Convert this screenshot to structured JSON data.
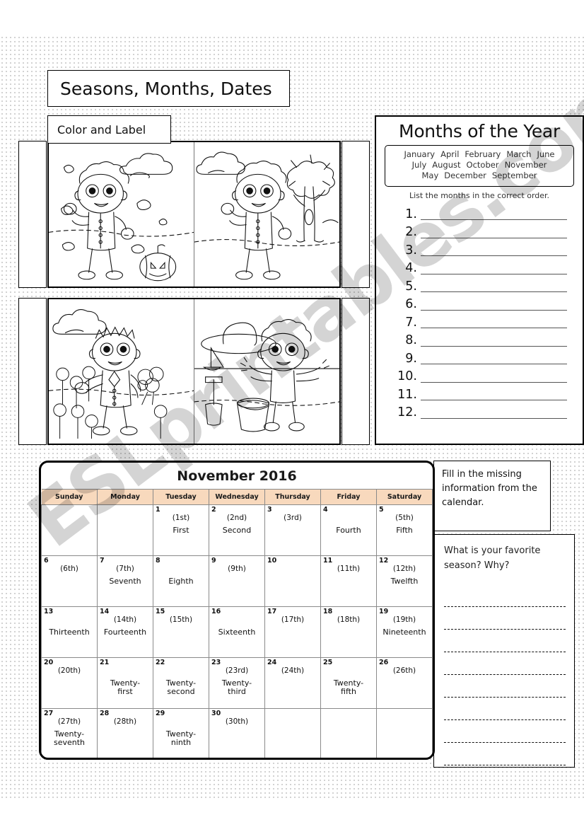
{
  "page": {
    "title": "Seasons, Months, Dates",
    "subtitle": "Color and Label",
    "watermark": "ESLprintables.com"
  },
  "seasons": {
    "panels": [
      {
        "name": "fall-boy-leaves-pumpkin",
        "season": "Fall"
      },
      {
        "name": "autumn-boy-tree",
        "season": "Autumn"
      },
      {
        "name": "spring-boy-flowers",
        "season": "Spring"
      },
      {
        "name": "summer-boy-beach",
        "season": "Summer"
      }
    ]
  },
  "months": {
    "heading": "Months of the Year",
    "word_bank": [
      "January",
      "April",
      "February",
      "March",
      "June",
      "July",
      "August",
      "October",
      "November",
      "May",
      "December",
      "September"
    ],
    "instruction": "List the months in the correct order.",
    "numbers": [
      "1.",
      "2.",
      "3.",
      "4.",
      "5.",
      "6.",
      "7.",
      "8.",
      "9.",
      "10.",
      "11.",
      "12."
    ]
  },
  "calendar": {
    "title": "November 2016",
    "weekdays": [
      "Sunday",
      "Monday",
      "Tuesday",
      "Wednesday",
      "Thursday",
      "Friday",
      "Saturday"
    ],
    "weeks": [
      [
        {
          "day": "",
          "ordinal": "",
          "word": ""
        },
        {
          "day": "",
          "ordinal": "",
          "word": ""
        },
        {
          "day": "1",
          "ordinal": "(1st)",
          "word": "First"
        },
        {
          "day": "2",
          "ordinal": "(2nd)",
          "word": "Second"
        },
        {
          "day": "3",
          "ordinal": "(3rd)",
          "word": ""
        },
        {
          "day": "4",
          "ordinal": "",
          "word": "Fourth"
        },
        {
          "day": "5",
          "ordinal": "(5th)",
          "word": "Fifth"
        }
      ],
      [
        {
          "day": "6",
          "ordinal": "(6th)",
          "word": ""
        },
        {
          "day": "7",
          "ordinal": "(7th)",
          "word": "Seventh"
        },
        {
          "day": "8",
          "ordinal": "",
          "word": "Eighth"
        },
        {
          "day": "9",
          "ordinal": "(9th)",
          "word": ""
        },
        {
          "day": "10",
          "ordinal": "",
          "word": ""
        },
        {
          "day": "11",
          "ordinal": "(11th)",
          "word": ""
        },
        {
          "day": "12",
          "ordinal": "(12th)",
          "word": "Twelfth"
        }
      ],
      [
        {
          "day": "13",
          "ordinal": "",
          "word": "Thirteenth"
        },
        {
          "day": "14",
          "ordinal": "(14th)",
          "word": "Fourteenth"
        },
        {
          "day": "15",
          "ordinal": "(15th)",
          "word": ""
        },
        {
          "day": "16",
          "ordinal": "",
          "word": "Sixteenth"
        },
        {
          "day": "17",
          "ordinal": "(17th)",
          "word": ""
        },
        {
          "day": "18",
          "ordinal": "(18th)",
          "word": ""
        },
        {
          "day": "19",
          "ordinal": "(19th)",
          "word": "Nineteenth"
        }
      ],
      [
        {
          "day": "20",
          "ordinal": "(20th)",
          "word": ""
        },
        {
          "day": "21",
          "ordinal": "",
          "word": "Twenty-first"
        },
        {
          "day": "22",
          "ordinal": "",
          "word": "Twenty-second"
        },
        {
          "day": "23",
          "ordinal": "(23rd)",
          "word": "Twenty-third"
        },
        {
          "day": "24",
          "ordinal": "(24th)",
          "word": ""
        },
        {
          "day": "25",
          "ordinal": "",
          "word": "Twenty-fifth"
        },
        {
          "day": "26",
          "ordinal": "(26th)",
          "word": ""
        }
      ],
      [
        {
          "day": "27",
          "ordinal": "(27th)",
          "word": "Twenty-seventh"
        },
        {
          "day": "28",
          "ordinal": "(28th)",
          "word": ""
        },
        {
          "day": "29",
          "ordinal": "",
          "word": "Twenty-ninth"
        },
        {
          "day": "30",
          "ordinal": "(30th)",
          "word": ""
        },
        {
          "day": "",
          "ordinal": "",
          "word": ""
        },
        {
          "day": "",
          "ordinal": "",
          "word": ""
        },
        {
          "day": "",
          "ordinal": "",
          "word": ""
        }
      ]
    ],
    "header_color": "#f8d9bd"
  },
  "fill_box": {
    "text": "Fill in the missing information from the calendar."
  },
  "season_question": {
    "text": "What is your favorite season? Why?",
    "line_count": 8
  }
}
